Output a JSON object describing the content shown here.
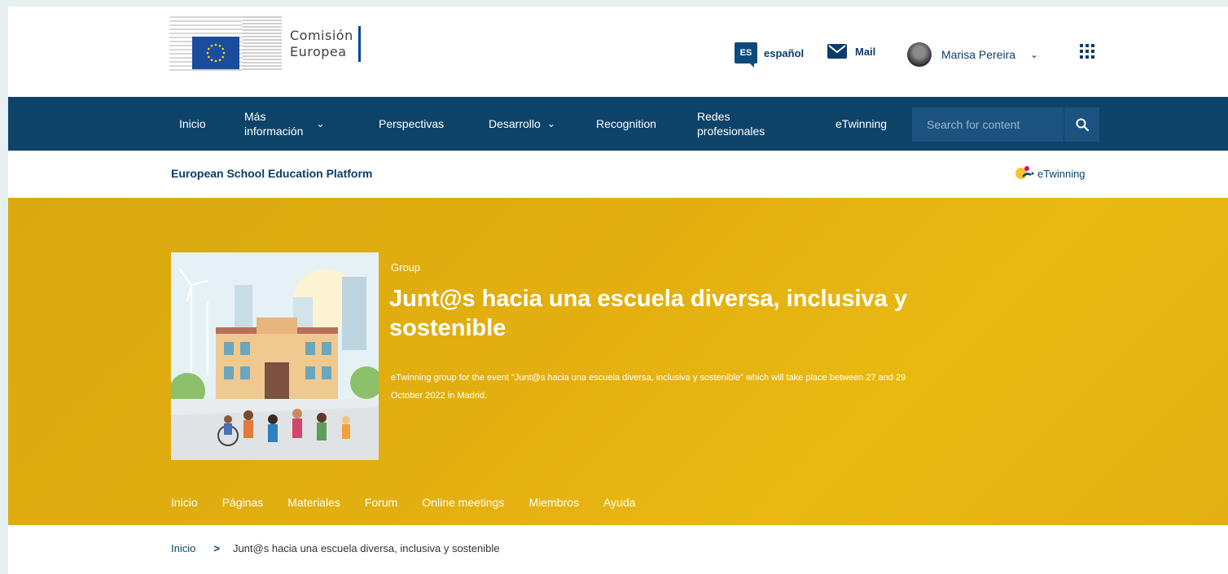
{
  "logo": {
    "line1": "Comisión",
    "line2": "Europea"
  },
  "header": {
    "language_code": "ES",
    "language_label": "español",
    "mail_label": "Mail",
    "user_name": "Marisa Pereira"
  },
  "nav": {
    "items": [
      {
        "label": "Inicio"
      },
      {
        "label": "Más información",
        "line1": "Más",
        "line2": "información"
      },
      {
        "label": "Perspectivas"
      },
      {
        "label": "Desarrollo"
      },
      {
        "label": "Recognition"
      },
      {
        "label": "Redes profesionales",
        "line1": "Redes",
        "line2": "profesionales"
      },
      {
        "label": "eTwinning"
      }
    ],
    "search_placeholder": "Search for content"
  },
  "platform": {
    "title": "European School Education Platform",
    "partner_logo_text": "eTwinning"
  },
  "hero": {
    "kicker": "Group",
    "title": "Junt@s hacia una escuela diversa, inclusiva y sostenible",
    "description": "eTwinning group for the event \"Junt@s hacia una escuela diversa, inclusiva y sostenible\" which will take place between 27 and 29 October 2022 in Madrid.",
    "tabs": [
      {
        "label": "Inicio",
        "active": true
      },
      {
        "label": "Páginas"
      },
      {
        "label": "Materiales"
      },
      {
        "label": "Forum"
      },
      {
        "label": "Online meetings"
      },
      {
        "label": "Miembros"
      },
      {
        "label": "Ayuda"
      }
    ]
  },
  "breadcrumb": {
    "home": "Inicio",
    "separator": ">",
    "current": "Junt@s hacia una escuela diversa, inclusiva y sostenible"
  },
  "colors": {
    "nav_bg": "#0e4369",
    "hero_bg": "#e3af10",
    "brand_text": "#0b3d6b"
  },
  "icons": [
    "eu-flag-icon",
    "mail-icon",
    "chevron-down-icon",
    "apps-grid-icon",
    "search-icon",
    "etwinning-logo-icon"
  ]
}
